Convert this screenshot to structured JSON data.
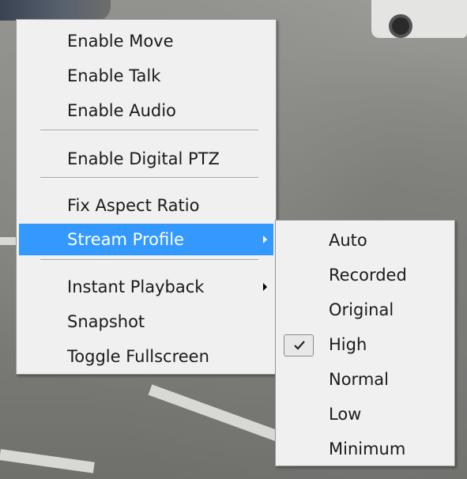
{
  "main_menu": {
    "items": [
      {
        "label": "Enable Move"
      },
      {
        "label": "Enable Talk"
      },
      {
        "label": "Enable Audio"
      },
      {
        "label": "Enable Digital PTZ"
      },
      {
        "label": "Fix Aspect Ratio"
      },
      {
        "label": "Stream Profile",
        "selected": true,
        "has_submenu": true
      },
      {
        "label": "Instant Playback",
        "has_submenu": true
      },
      {
        "label": "Snapshot"
      },
      {
        "label": "Toggle Fullscreen"
      }
    ]
  },
  "stream_profile_submenu": {
    "items": [
      {
        "label": "Auto"
      },
      {
        "label": "Recorded"
      },
      {
        "label": "Original"
      },
      {
        "label": "High",
        "checked": true
      },
      {
        "label": "Normal"
      },
      {
        "label": "Low"
      },
      {
        "label": "Minimum"
      }
    ]
  },
  "colors": {
    "selection_highlight": "#3399ff",
    "menu_background": "#f0f0f0"
  },
  "icons": {
    "submenu_arrow": "triangle-right-icon",
    "checkmark": "checkmark-icon"
  }
}
